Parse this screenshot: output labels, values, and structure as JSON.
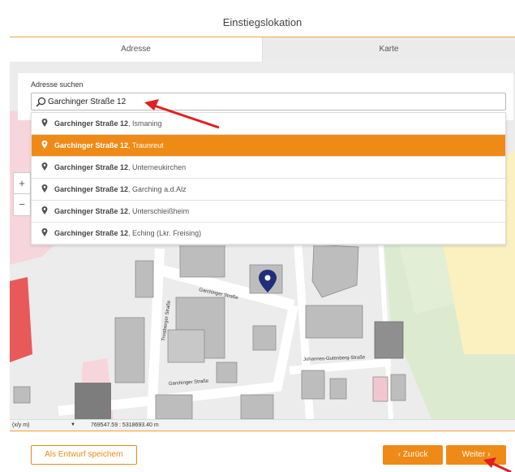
{
  "dialog": {
    "title": "Einstiegslokation",
    "tabs": [
      {
        "label": "Adresse",
        "active": true
      },
      {
        "label": "Karte",
        "active": false
      }
    ]
  },
  "search": {
    "label": "Adresse suchen",
    "value": "Garchinger Straße 12",
    "suggestions": [
      {
        "street": "Garchinger Straße 12",
        "place": ", Ismaning",
        "selected": false
      },
      {
        "street": "Garchinger Straße 12",
        "place": ", Traunreut",
        "selected": true
      },
      {
        "street": "Garchinger Straße 12",
        "place": ", Unterneukirchen",
        "selected": false
      },
      {
        "street": "Garchinger Straße 12",
        "place": ", Garching a.d.Alz",
        "selected": false
      },
      {
        "street": "Garchinger Straße 12",
        "place": ", Unterschleißheim",
        "selected": false
      },
      {
        "street": "Garchinger Straße 12",
        "place": ", Eching (Lkr. Freising)",
        "selected": false
      }
    ]
  },
  "map": {
    "zoom_in": "+",
    "zoom_out": "−",
    "street_labels": {
      "garchinger_1": "Garchinger Straße",
      "garchinger_2": "Garchinger Straße",
      "trostberger": "Trostberger Straße",
      "gutenberg": "Johannes-Gutenberg-Straße"
    },
    "marker_icon": "location-pin-icon"
  },
  "coordinates": {
    "crs": "(x/y m)",
    "value": "769547.59 : 5318693.40 m"
  },
  "footer": {
    "draft_label": "Als Entwurf speichern",
    "back_label": "‹  Zurück",
    "next_label": "Weiter  ›"
  },
  "colors": {
    "accent": "#ef8a16",
    "annotation_arrow": "#e02020"
  }
}
